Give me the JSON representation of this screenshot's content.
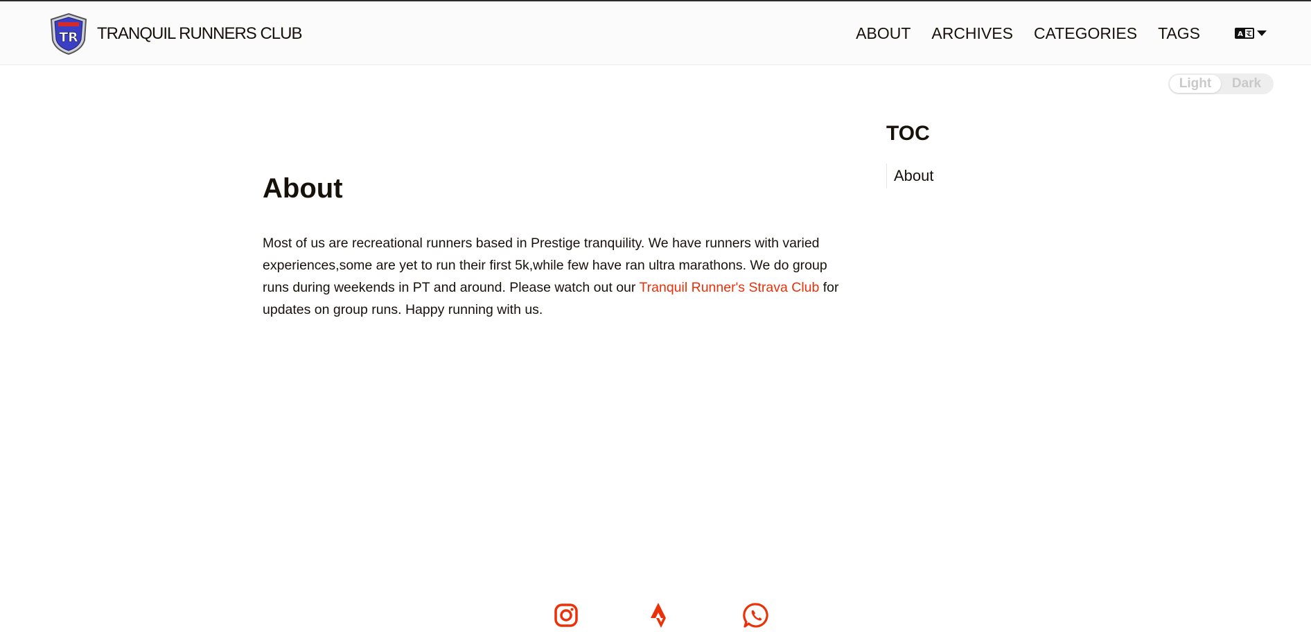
{
  "header": {
    "site_title": "TRANQUIL RUNNERS CLUB",
    "logo_text": "TR",
    "nav": [
      {
        "label": "ABOUT"
      },
      {
        "label": "ARCHIVES"
      },
      {
        "label": "CATEGORIES"
      },
      {
        "label": "TAGS"
      }
    ],
    "language_icon": "translate-icon"
  },
  "theme_toggle": {
    "light_label": "Light",
    "dark_label": "Dark",
    "selected": "Light"
  },
  "main": {
    "title": "About",
    "paragraph_before_link": "Most of us are recreational runners based in Prestige tranquility. We have runners with varied experiences,some are yet to run their first 5k,while few have ran ultra marathons. We do group runs during weekends in PT and around. Please watch out our ",
    "link_text": "Tranquil Runner's Strava Club",
    "paragraph_after_link": " for updates on group runs. Happy running with us."
  },
  "toc": {
    "heading": "TOC",
    "items": [
      {
        "label": "About"
      }
    ]
  },
  "footer": {
    "social": [
      {
        "icon": "instagram-icon"
      },
      {
        "icon": "strava-icon"
      },
      {
        "icon": "whatsapp-icon"
      }
    ],
    "accent_color": "#ec3008"
  }
}
